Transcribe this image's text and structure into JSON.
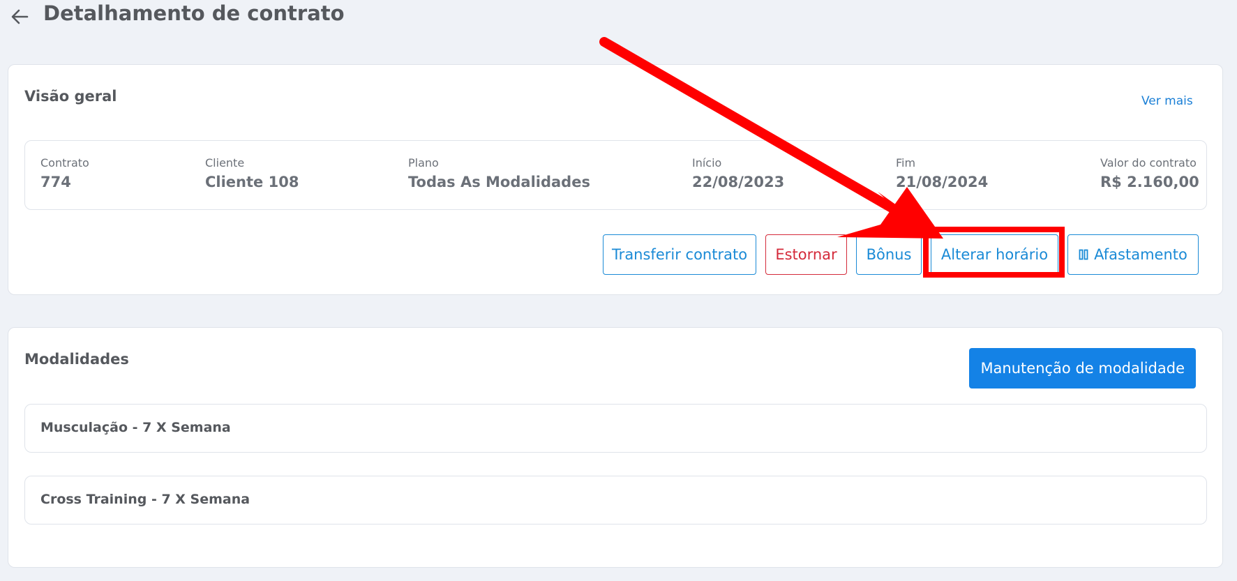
{
  "header": {
    "title": "Detalhamento de contrato"
  },
  "overview": {
    "title": "Visão geral",
    "see_more": "Ver mais",
    "fields": [
      {
        "label": "Contrato",
        "value": "774"
      },
      {
        "label": "Cliente",
        "value": "Cliente 108"
      },
      {
        "label": "Plano",
        "value": "Todas As Modalidades"
      },
      {
        "label": "Início",
        "value": "22/08/2023"
      },
      {
        "label": "Fim",
        "value": "21/08/2024"
      },
      {
        "label": "Valor do contrato",
        "value": "R$ 2.160,00"
      }
    ],
    "actions": {
      "transfer": "Transferir contrato",
      "reverse": "Estornar",
      "bonus": "Bônus",
      "change_schedule": "Alterar horário",
      "leave": "Afastamento"
    }
  },
  "modalities": {
    "title": "Modalidades",
    "maintenance_button": "Manutenção de modalidade",
    "items": [
      {
        "label": "Musculação - 7 X Semana"
      },
      {
        "label": "Cross Training - 7 X Semana"
      }
    ]
  },
  "colors": {
    "primary": "#1482e6",
    "outline": "#1a8ad6",
    "danger": "#d42a3a",
    "annotation": "#ff0000",
    "background": "#eff2f7"
  }
}
